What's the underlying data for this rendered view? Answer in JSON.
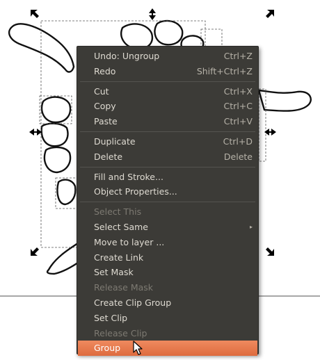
{
  "context_menu": {
    "items": [
      {
        "label": "Undo: Ungroup",
        "accel": "Ctrl+Z"
      },
      {
        "label": "Redo",
        "accel": "Shift+Ctrl+Z"
      },
      {
        "label": "Cut",
        "accel": "Ctrl+X"
      },
      {
        "label": "Copy",
        "accel": "Ctrl+C"
      },
      {
        "label": "Paste",
        "accel": "Ctrl+V"
      },
      {
        "label": "Duplicate",
        "accel": "Ctrl+D"
      },
      {
        "label": "Delete",
        "accel": "Delete"
      },
      {
        "label": "Fill and Stroke..."
      },
      {
        "label": "Object Properties..."
      },
      {
        "label": "Select This"
      },
      {
        "label": "Select Same"
      },
      {
        "label": "Move to layer ..."
      },
      {
        "label": "Create Link"
      },
      {
        "label": "Set Mask"
      },
      {
        "label": "Release Mask"
      },
      {
        "label": "Create Clip Group"
      },
      {
        "label": "Set Clip"
      },
      {
        "label": "Release Clip"
      },
      {
        "label": "Group"
      }
    ],
    "disabled_items": [
      "Select This",
      "Release Mask",
      "Release Clip"
    ],
    "highlighted_item": "Group",
    "submenu_items": [
      "Select Same"
    ]
  },
  "colors": {
    "menu_background": "#3c3b37",
    "menu_text": "#dfdbd2",
    "disabled_text": "#7d7a72",
    "highlight": "#e2703f"
  },
  "canvas": {
    "cursor": "arrow-cursor-icon"
  }
}
